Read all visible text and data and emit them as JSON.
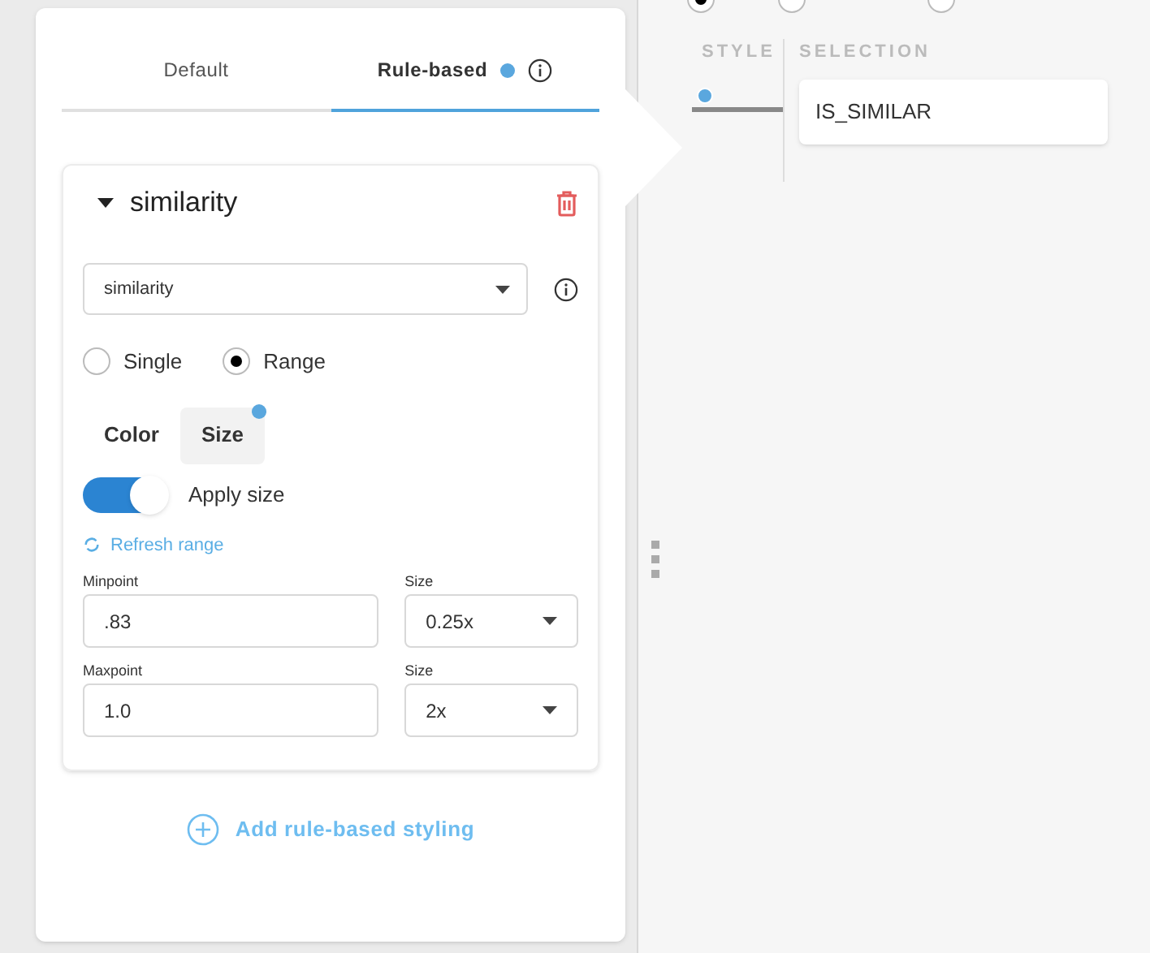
{
  "tabs": [
    {
      "label": "Default",
      "selected": false,
      "badge": false,
      "info": false
    },
    {
      "label": "Rule-based",
      "selected": true,
      "badge": true,
      "info": true
    }
  ],
  "rule": {
    "title": "similarity",
    "expanded": true,
    "attribute": "similarity",
    "modes": [
      {
        "label": "Single",
        "selected": false
      },
      {
        "label": "Range",
        "selected": true
      }
    ],
    "style_tabs": [
      {
        "label": "Color",
        "selected": false,
        "badge": false
      },
      {
        "label": "Size",
        "selected": true,
        "badge": true
      }
    ],
    "toggle": {
      "label": "Apply size",
      "on": true
    },
    "refresh": "Refresh range",
    "points": [
      {
        "label": "Minpoint",
        "value": ".83",
        "size_label": "Size",
        "size": "0.25x"
      },
      {
        "label": "Maxpoint",
        "value": "1.0",
        "size_label": "Size",
        "size": "2x"
      }
    ]
  },
  "add_button": "Add rule-based styling",
  "filter": [
    {
      "selected": true
    },
    {
      "selected": false
    },
    {
      "selected": false
    }
  ],
  "columns": [
    "STYLE",
    "SELECTION"
  ],
  "rows": [
    {
      "selection": "IS_SIMILAR",
      "color": "#5aa7de"
    }
  ]
}
